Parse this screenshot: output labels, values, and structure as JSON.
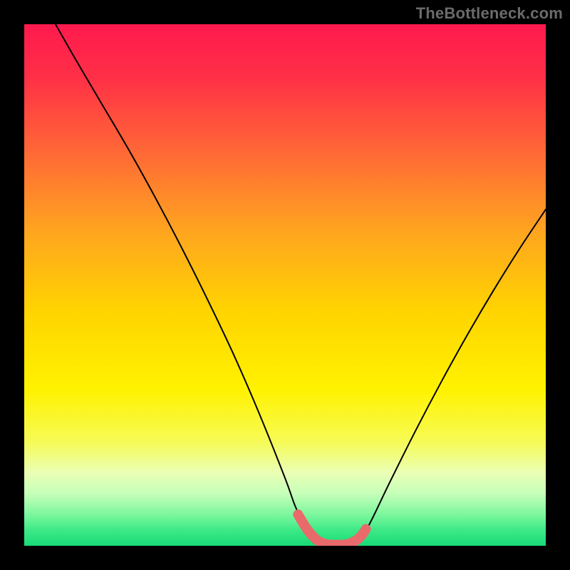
{
  "watermark": "TheBottleneck.com",
  "chart_data": {
    "type": "line",
    "title": "",
    "xlabel": "",
    "ylabel": "",
    "xlim": [
      0,
      100
    ],
    "ylim": [
      0,
      100
    ],
    "series": [
      {
        "name": "bottleneck-curve",
        "x": [
          6,
          10,
          15,
          20,
          25,
          30,
          35,
          40,
          45,
          50,
          52,
          54,
          56,
          58,
          60,
          62,
          64,
          66,
          70,
          75,
          80,
          85,
          90,
          95,
          100
        ],
        "y": [
          100,
          93,
          84.5,
          76,
          67,
          57.5,
          47.5,
          37,
          25.5,
          13,
          7.5,
          3.5,
          1.2,
          0.3,
          0.2,
          0.3,
          1.3,
          3.8,
          12,
          22,
          31.5,
          40.5,
          49,
          57,
          64.5
        ]
      }
    ],
    "highlight_band": {
      "name": "optimal-range",
      "x": [
        52.5,
        54,
        55,
        56,
        57,
        58,
        59,
        60,
        61,
        62,
        63,
        64,
        65,
        65.5
      ],
      "y": [
        6.0,
        3.5,
        2.2,
        1.2,
        0.6,
        0.3,
        0.2,
        0.2,
        0.2,
        0.3,
        0.7,
        1.3,
        2.4,
        3.2
      ]
    },
    "background_gradient": {
      "stops": [
        {
          "offset": 0.0,
          "color": "#ff1a4e"
        },
        {
          "offset": 0.1,
          "color": "#ff2f47"
        },
        {
          "offset": 0.25,
          "color": "#ff6a35"
        },
        {
          "offset": 0.4,
          "color": "#ffa61f"
        },
        {
          "offset": 0.55,
          "color": "#ffd400"
        },
        {
          "offset": 0.7,
          "color": "#fff200"
        },
        {
          "offset": 0.8,
          "color": "#f6fb55"
        },
        {
          "offset": 0.86,
          "color": "#eaffb5"
        },
        {
          "offset": 0.9,
          "color": "#c6ffb9"
        },
        {
          "offset": 0.94,
          "color": "#7cf79e"
        },
        {
          "offset": 0.97,
          "color": "#3de987"
        },
        {
          "offset": 1.0,
          "color": "#17db77"
        }
      ]
    }
  }
}
